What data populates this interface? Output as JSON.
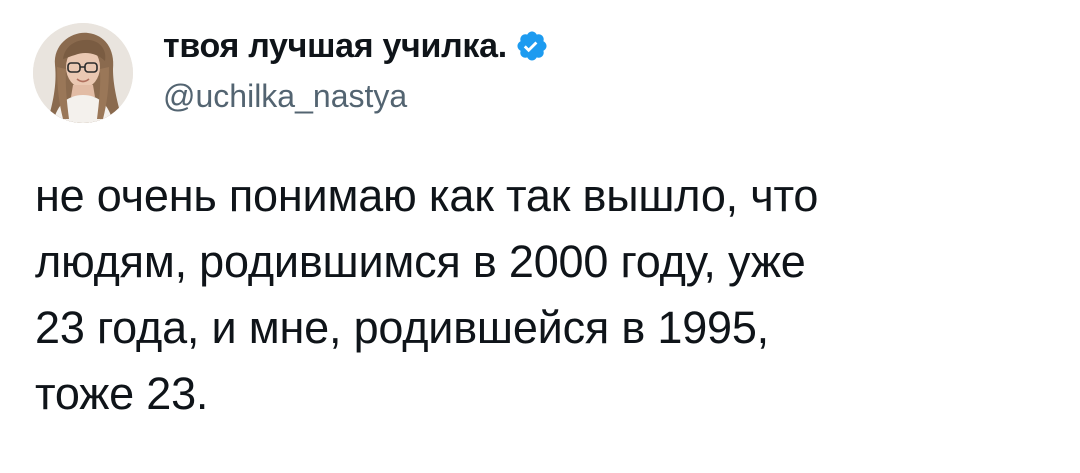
{
  "tweet": {
    "author": {
      "display_name": "твоя лучшая училка.",
      "handle": "@uchilka_nastya",
      "verified_icon": "verified-badge-icon",
      "verified_color": "#1d9bf0",
      "avatar": "avatar-photo"
    },
    "text": "не очень понимаю как так вышло, что\nлюдям, родившимся в 2000 году, уже\n23 года, и мне, родившейся в 1995,\nтоже 23."
  }
}
